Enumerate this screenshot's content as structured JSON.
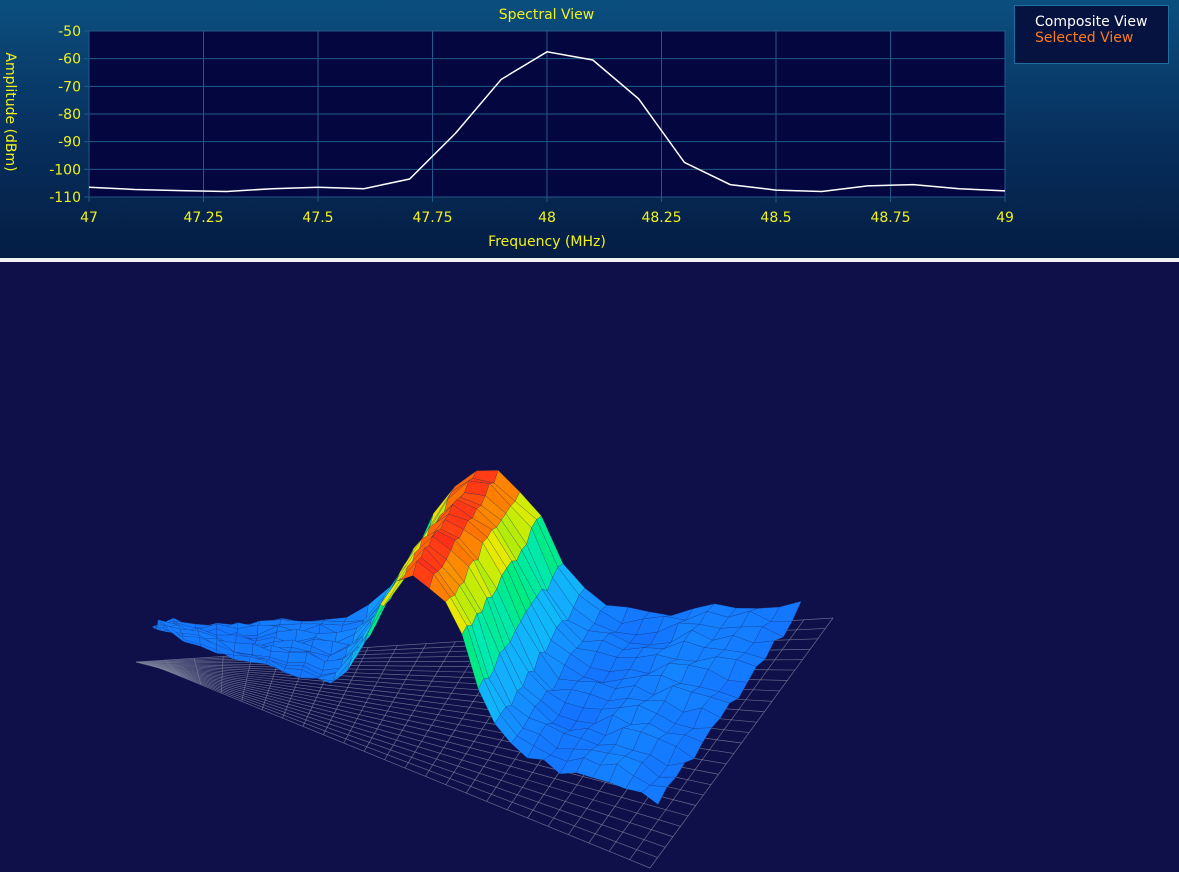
{
  "spectral": {
    "title": "Spectral View",
    "xlabel": "Frequency (MHz)",
    "ylabel": "Amplitude (dBm)"
  },
  "legend": {
    "composite": "Composite View",
    "selected": "Selected View"
  },
  "colors": {
    "axis_text": "#f2f21a",
    "trace": "#ffffff",
    "selected": "#ff7a1a",
    "plot_bg": "#04073f",
    "grid": "#1f5a8a"
  },
  "chart_data": [
    {
      "type": "line",
      "title": "Spectral View",
      "xlabel": "Frequency (MHz)",
      "ylabel": "Amplitude (dBm)",
      "xlim": [
        47,
        49
      ],
      "ylim": [
        -110,
        -50
      ],
      "xticks": [
        47,
        47.25,
        47.5,
        47.75,
        48,
        48.25,
        48.5,
        48.75,
        49
      ],
      "xtick_labels": [
        "47",
        "47.25",
        "47.5",
        "47.75",
        "48",
        "48.25",
        "48.5",
        "48.75",
        "49"
      ],
      "yticks": [
        -50,
        -60,
        -70,
        -80,
        -90,
        -100,
        -110
      ],
      "ytick_labels": [
        "-50",
        "-60",
        "-70",
        "-80",
        "-90",
        "-100",
        "-110"
      ],
      "grid": true,
      "legend_position": "top-right",
      "series": [
        {
          "name": "Composite View",
          "x": [
            47,
            47.1,
            47.2,
            47.3,
            47.4,
            47.5,
            47.6,
            47.7,
            47.8,
            47.9,
            48,
            48.1,
            48.2,
            48.3,
            48.4,
            48.5,
            48.6,
            48.7,
            48.8,
            48.9,
            49
          ],
          "y": [
            -106.5,
            -107.3,
            -107.7,
            -108,
            -107,
            -106.5,
            -107,
            -103.5,
            -87,
            -67.5,
            -57.5,
            -60.5,
            -74.5,
            -97.5,
            -105.5,
            -107.5,
            -108,
            -106,
            -105.5,
            -107,
            -107.8
          ]
        }
      ]
    },
    {
      "type": "surface",
      "title": "",
      "description_note": "",
      "grid": true
    }
  ]
}
